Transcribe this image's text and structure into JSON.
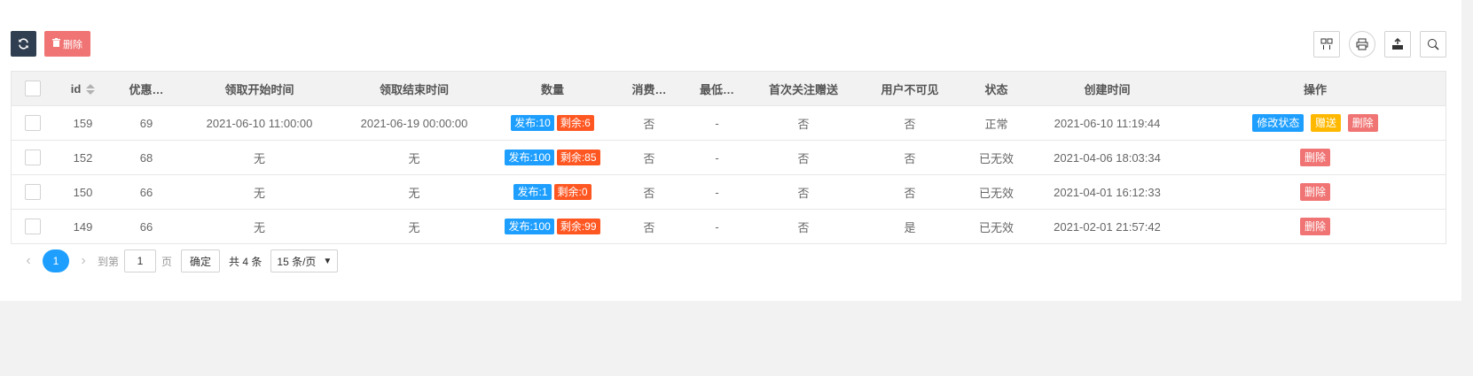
{
  "toolbar": {
    "refresh_icon": "refresh-icon",
    "delete_label": "删除",
    "tools": [
      "columns-icon",
      "print-icon",
      "export-icon",
      "search-icon"
    ]
  },
  "table": {
    "headers": [
      "id",
      "优惠…",
      "领取开始时间",
      "领取结束时间",
      "数量",
      "消费…",
      "最低…",
      "首次关注赠送",
      "用户不可见",
      "状态",
      "创建时间",
      "操作"
    ],
    "rows": [
      {
        "id": "159",
        "coupon": "69",
        "start": "2021-06-10 11:00:00",
        "end": "2021-06-19 00:00:00",
        "issued": "发布:10",
        "remain": "剩余:6",
        "consume": "否",
        "min": "-",
        "follow": "否",
        "invisible": "否",
        "status": "正常",
        "created": "2021-06-10 11:19:44",
        "ops": [
          "修改状态",
          "赠送",
          "删除"
        ]
      },
      {
        "id": "152",
        "coupon": "68",
        "start": "无",
        "end": "无",
        "issued": "发布:100",
        "remain": "剩余:85",
        "consume": "否",
        "min": "-",
        "follow": "否",
        "invisible": "否",
        "status": "已无效",
        "created": "2021-04-06 18:03:34",
        "ops": [
          "删除"
        ]
      },
      {
        "id": "150",
        "coupon": "66",
        "start": "无",
        "end": "无",
        "issued": "发布:1",
        "remain": "剩余:0",
        "consume": "否",
        "min": "-",
        "follow": "否",
        "invisible": "否",
        "status": "已无效",
        "created": "2021-04-01 16:12:33",
        "ops": [
          "删除"
        ]
      },
      {
        "id": "149",
        "coupon": "66",
        "start": "无",
        "end": "无",
        "issued": "发布:100",
        "remain": "剩余:99",
        "consume": "否",
        "min": "-",
        "follow": "否",
        "invisible": "是",
        "status": "已无效",
        "created": "2021-02-01 21:57:42",
        "ops": [
          "删除"
        ]
      }
    ]
  },
  "pager": {
    "current": "1",
    "goto_label": "到第",
    "goto_value": "1",
    "page_label": "页",
    "confirm": "确定",
    "total": "共 4 条",
    "page_size": "15 条/页"
  },
  "colors": {
    "blue": "#1e9fff",
    "orange": "#ff5722",
    "yellow": "#ffb800",
    "red": "#f07474",
    "dark": "#2f3e50"
  }
}
